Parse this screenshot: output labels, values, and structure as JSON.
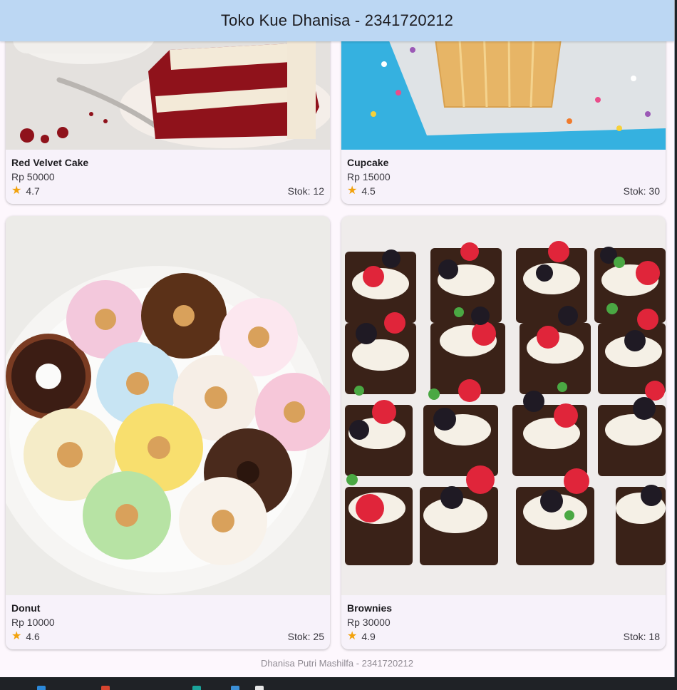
{
  "app": {
    "title": "Toko Kue Dhanisa - 2341720212"
  },
  "products": [
    {
      "name": "Red Velvet Cake",
      "price": "Rp 50000",
      "rating": "4.7",
      "stock": "Stok: 12",
      "image": "red-velvet-cake-image"
    },
    {
      "name": "Cupcake",
      "price": "Rp 15000",
      "rating": "4.5",
      "stock": "Stok: 30",
      "image": "cupcake-image"
    },
    {
      "name": "Donut",
      "price": "Rp 10000",
      "rating": "4.6",
      "stock": "Stok: 25",
      "image": "donut-image"
    },
    {
      "name": "Brownies",
      "price": "Rp 30000",
      "rating": "4.9",
      "stock": "Stok: 18",
      "image": "brownies-image"
    }
  ],
  "footer": {
    "text": "Dhanisa Putri Mashilfa - 2341720212"
  },
  "icons": {
    "rating": "star-icon"
  },
  "colors": {
    "appbar": "#bcd7f3",
    "star": "#f2a20c",
    "card": "#f7f2fa",
    "background": "#fdf7fd"
  }
}
